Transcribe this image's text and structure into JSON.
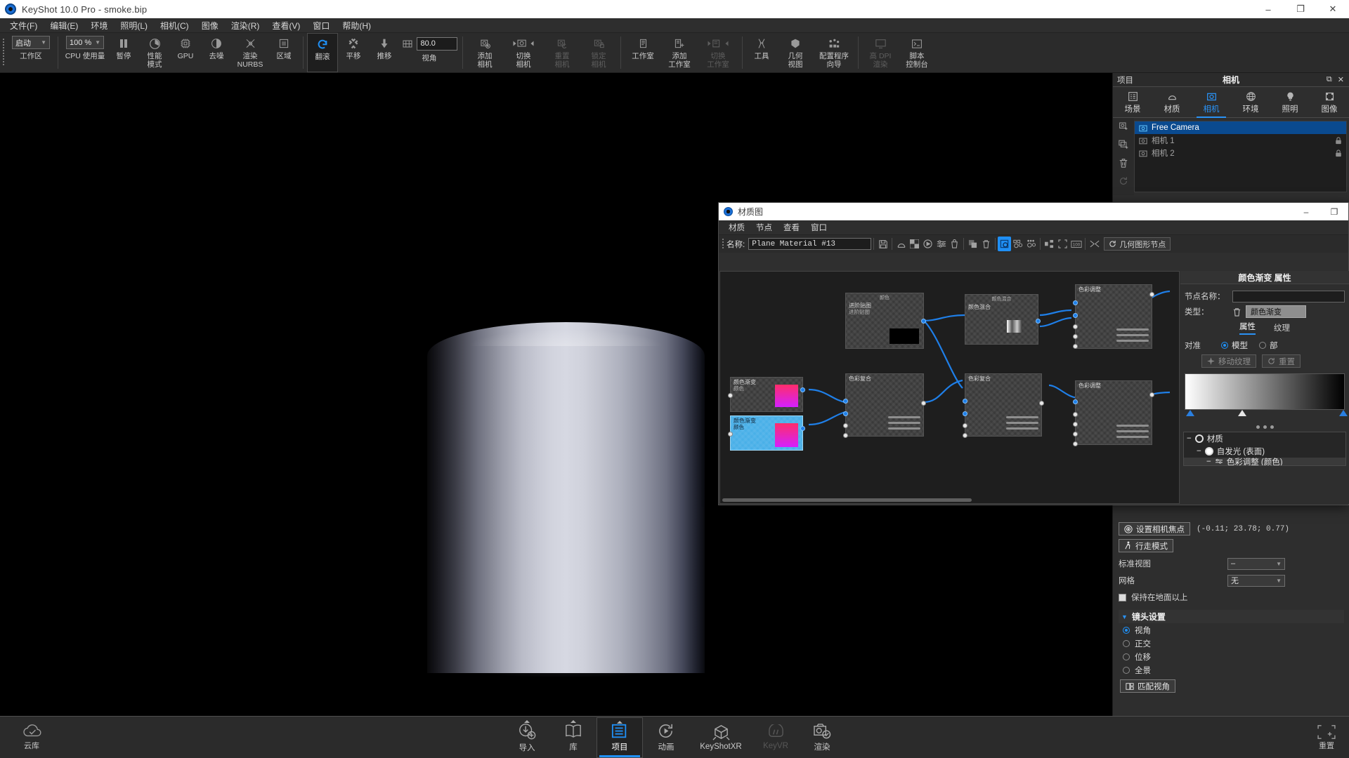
{
  "titlebar": {
    "app_title": "KeyShot 10.0 Pro  - smoke.bip",
    "minimize": "–",
    "maximize": "❐",
    "close": "✕"
  },
  "menubar": {
    "items": [
      {
        "label": "文件(F)"
      },
      {
        "label": "编辑(E)"
      },
      {
        "label": "环境"
      },
      {
        "label": "照明(L)"
      },
      {
        "label": "相机(C)"
      },
      {
        "label": "图像"
      },
      {
        "label": "渲染(R)"
      },
      {
        "label": "查看(V)"
      },
      {
        "label": "窗口"
      },
      {
        "label": "帮助(H)"
      }
    ]
  },
  "toolbar": {
    "workspace_value": "启动",
    "workspace_label": "工作区",
    "cpu_value": "100 %",
    "cpu_label": "CPU 使用量",
    "fov_value": "80.0",
    "fov_label": "视角",
    "items": [
      {
        "label": "暂停",
        "icon": "pause-icon",
        "state": "normal"
      },
      {
        "label": "性能\n模式",
        "icon": "performance-icon",
        "state": "normal"
      },
      {
        "label": "GPU",
        "icon": "gpu-icon",
        "state": "normal"
      },
      {
        "label": "去噪",
        "icon": "denoise-icon",
        "state": "normal"
      },
      {
        "label": "渲染\nNURBS",
        "icon": "nurbs-icon",
        "state": "normal"
      },
      {
        "label": "区域",
        "icon": "region-icon",
        "state": "normal"
      },
      {
        "label": "翻滚",
        "icon": "orbit-icon",
        "state": "active"
      },
      {
        "label": "平移",
        "icon": "pan-icon",
        "state": "normal"
      },
      {
        "label": "推移",
        "icon": "dolly-icon",
        "state": "normal"
      },
      {
        "label": "添加\n相机",
        "icon": "add-camera-icon",
        "state": "normal"
      },
      {
        "label": "切换\n相机",
        "icon": "switch-camera-icon",
        "state": "normal"
      },
      {
        "label": "重置\n相机",
        "icon": "reset-camera-icon",
        "state": "disabled"
      },
      {
        "label": "锁定\n相机",
        "icon": "lock-camera-icon",
        "state": "disabled"
      },
      {
        "label": "工作室",
        "icon": "studio-icon",
        "state": "normal"
      },
      {
        "label": "添加\n工作室",
        "icon": "add-studio-icon",
        "state": "normal"
      },
      {
        "label": "切换\n工作室",
        "icon": "switch-studio-icon",
        "state": "disabled"
      },
      {
        "label": "工具",
        "icon": "tools-icon",
        "state": "normal"
      },
      {
        "label": "几何\n视图",
        "icon": "geometry-view-icon",
        "state": "normal"
      },
      {
        "label": "配置程序\n向导",
        "icon": "configurator-wizard-icon",
        "state": "normal"
      },
      {
        "label": "高 DPI\n渲染",
        "icon": "high-dpi-icon",
        "state": "disabled"
      },
      {
        "label": "脚本\n控制台",
        "icon": "script-console-icon",
        "state": "normal"
      }
    ]
  },
  "right_panel": {
    "dock_label": "项目",
    "title": "相机",
    "undock_icon": "undock-icon",
    "close_icon": "close-icon",
    "tabs": [
      {
        "label": "场景",
        "icon": "scene-icon",
        "selected": false
      },
      {
        "label": "材质",
        "icon": "material-icon",
        "selected": false
      },
      {
        "label": "相机",
        "icon": "camera-icon",
        "selected": true
      },
      {
        "label": "环境",
        "icon": "environment-icon",
        "selected": false
      },
      {
        "label": "照明",
        "icon": "lighting-icon",
        "selected": false
      },
      {
        "label": "图像",
        "icon": "image-icon",
        "selected": false
      }
    ],
    "side_tools": [
      {
        "icon": "add-camera-icon",
        "enabled": true
      },
      {
        "icon": "duplicate-camera-icon",
        "enabled": true
      },
      {
        "icon": "delete-icon",
        "enabled": true
      },
      {
        "icon": "reset-icon",
        "enabled": false
      }
    ],
    "cameras": [
      {
        "name": "Free Camera",
        "selected": true,
        "locked": false
      },
      {
        "name": "相机 1",
        "selected": false,
        "locked": true
      },
      {
        "name": "相机 2",
        "selected": false,
        "locked": true
      }
    ],
    "camera_props": {
      "set_focus_button": "设置相机焦点",
      "coordinates": "(-0.11; 23.78; 0.77)",
      "walk_mode_button": "行走模式",
      "standard_view_label": "标准视图",
      "standard_view_value": "–",
      "grid_label": "网格",
      "grid_value": "无",
      "keep_above_ground_label": "保持在地面以上",
      "keep_above_ground_checked": true,
      "lens_section": "镜头设置",
      "lens_options": [
        {
          "label": "视角",
          "selected": true
        },
        {
          "label": "正交",
          "selected": false
        },
        {
          "label": "位移",
          "selected": false
        },
        {
          "label": "全景",
          "selected": false
        }
      ],
      "match_view_button": "匹配视角"
    }
  },
  "material_graph": {
    "window_title": "材质图",
    "minimize": "–",
    "maximize": "❐",
    "menu": [
      {
        "label": "材质"
      },
      {
        "label": "节点"
      },
      {
        "label": "查看"
      },
      {
        "label": "窗口"
      }
    ],
    "name_label": "名称:",
    "name_value": "Plane Material #13",
    "geometry_node_button": "几何图形节点",
    "toolbar_icons": [
      "save-icon",
      "material-sphere-icon",
      "checker-icon",
      "record-icon",
      "adjust-icon",
      "bucket-icon",
      "copy-icon",
      "delete-icon",
      "node-toggle-icon",
      "nodes-grid-icon",
      "nodes-dots-icon",
      "layout-icon",
      "fit-icon",
      "zoom-100-icon",
      "collapse-icon"
    ],
    "nodes": [
      {
        "id": "n1",
        "title": "颜色渐变",
        "sub": "颜色",
        "type": "gradient",
        "selected": false
      },
      {
        "id": "n2",
        "title": "颜色渐变",
        "sub": "颜色",
        "type": "gradient",
        "selected": true
      },
      {
        "id": "n3",
        "title": "进阶贴图",
        "sub": "进阶贴图",
        "sub2": "颜色",
        "type": "texture",
        "selected": false
      },
      {
        "id": "n4",
        "title": "颜色混合",
        "sub": "颜色混合",
        "type": "mix",
        "selected": false
      },
      {
        "id": "n5",
        "title": "色彩复合",
        "sub": "色彩复合",
        "type": "composite",
        "selected": false
      },
      {
        "id": "n6",
        "title": "色彩复合",
        "sub": "色彩复合",
        "type": "composite",
        "selected": false
      },
      {
        "id": "n7",
        "title": "色彩调整",
        "sub": "色彩调整",
        "type": "adjust",
        "selected": false
      },
      {
        "id": "n8",
        "title": "色彩调整",
        "sub": "色彩调整",
        "type": "adjust",
        "selected": false
      }
    ],
    "properties": {
      "title": "颜色渐变 属性",
      "node_name_label": "节点名称：",
      "node_name_value": "",
      "type_label": "类型：",
      "type_value": "颜色渐变",
      "delete_icon": "trash-icon",
      "tabs": [
        {
          "label": "属性",
          "selected": true
        },
        {
          "label": "纹理",
          "selected": false
        }
      ],
      "align_label": "对准",
      "align_options": [
        {
          "label": "模型",
          "selected": true
        },
        {
          "label": "部",
          "selected": false
        }
      ],
      "move_texture_button": "移动纹理",
      "reset_button": "重置",
      "tree": [
        {
          "label": "材质",
          "indent": 0
        },
        {
          "label": "自发光 (表面)",
          "indent": 1
        },
        {
          "label": "色彩调整 (颜色)",
          "indent": 2
        }
      ]
    }
  },
  "bottom_bar": {
    "cloud_label": "云库",
    "cloud_icon": "cloud-icon",
    "items": [
      {
        "label": "导入",
        "icon": "import-icon",
        "selected": false,
        "dim": false,
        "caret": true
      },
      {
        "label": "库",
        "icon": "library-icon",
        "selected": false,
        "dim": false,
        "caret": true
      },
      {
        "label": "项目",
        "icon": "project-icon",
        "selected": true,
        "dim": false,
        "caret": true
      },
      {
        "label": "动画",
        "icon": "animation-icon",
        "selected": false,
        "dim": false,
        "caret": false
      },
      {
        "label": "KeyShotXR",
        "icon": "keyshotxr-icon",
        "selected": false,
        "dim": false,
        "caret": false
      },
      {
        "label": "KeyVR",
        "icon": "keyvr-icon",
        "selected": false,
        "dim": true,
        "caret": false
      },
      {
        "label": "渲染",
        "icon": "render-icon",
        "selected": false,
        "dim": false,
        "caret": false
      }
    ],
    "fullscreen_label": "重置",
    "fullscreen_icon": "fullscreen-icon"
  },
  "colors": {
    "accent": "#1f8ff5",
    "selection": "#0a4a8f",
    "panel_bg": "#2e2e2e",
    "toolbar_bg": "#2b2b2b",
    "node_selected": "#49b0e8"
  }
}
